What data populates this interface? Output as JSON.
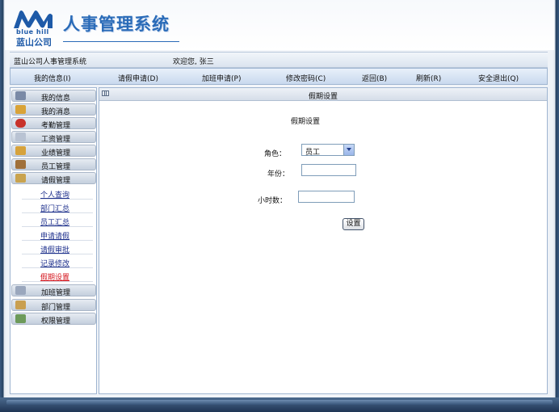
{
  "brand": {
    "name_en": "blue hill",
    "name_cn": "蓝山公司",
    "system_title": "人事管理系统"
  },
  "info_bar": {
    "system_name": "蓝山公司人事管理系统",
    "welcome": "欢迎您, 张三"
  },
  "nav": [
    {
      "label": "我的信息(I)"
    },
    {
      "label": "请假申请(D)"
    },
    {
      "label": "加班申请(P)"
    },
    {
      "label": "修改密码(C)"
    },
    {
      "label": "返回(B)"
    },
    {
      "label": "刷新(R)"
    },
    {
      "label": "安全退出(Q)"
    }
  ],
  "sidebar": {
    "menus": [
      {
        "label": "我的信息"
      },
      {
        "label": "我的消息"
      },
      {
        "label": "考勤管理"
      },
      {
        "label": "工资管理"
      },
      {
        "label": "业绩管理"
      },
      {
        "label": "员工管理"
      },
      {
        "label": "请假管理"
      },
      {
        "label": "加班管理"
      },
      {
        "label": "部门管理"
      },
      {
        "label": "权限管理"
      }
    ],
    "leave_submenu": [
      {
        "label": "个人查询"
      },
      {
        "label": "部门汇总"
      },
      {
        "label": "员工汇总"
      },
      {
        "label": "申请请假"
      },
      {
        "label": "请假审批"
      },
      {
        "label": "记录修改"
      },
      {
        "label": "假期设置"
      }
    ],
    "active_item": "假期设置",
    "active_color": "#d4141c"
  },
  "content": {
    "header_title": "假期设置",
    "form_title": "假期设置",
    "role_label": "角色：",
    "role_value": "员工",
    "year_label": "年份：",
    "year_value": "",
    "hours_label": "小时数：",
    "hours_value": "",
    "submit_label": "设置"
  }
}
